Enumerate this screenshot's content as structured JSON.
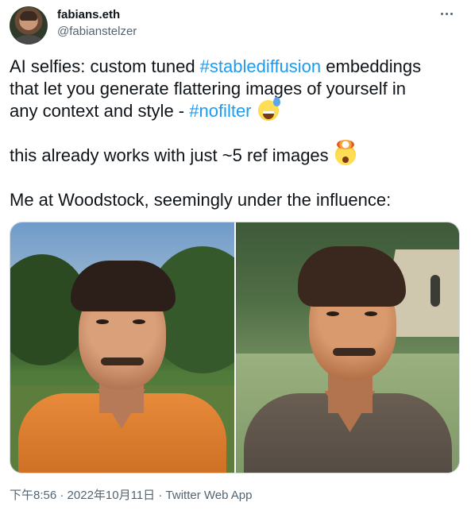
{
  "author": {
    "display_name": "fabians.eth",
    "handle": "@fabianstelzer",
    "avatar_icon": "profile-photo"
  },
  "more_icon": "more-horizontal-icon",
  "tweet": {
    "p1_line1_before": "AI selfies: custom tuned ",
    "p1_hashtag1": "#stablediffusion",
    "p1_line1_after": " embeddings",
    "p1_line2": "that let you generate flattering images of yourself in",
    "p1_line3_before": "any context and style - ",
    "p1_hashtag2": "#nofilter",
    "p1_emoji": "grinning-face-with-sweat-emoji",
    "p2_text": "this already works with just ~5 ref images",
    "p2_emoji": "exploding-head-emoji",
    "p3_text": "Me at Woodstock, seemingly under the influence:"
  },
  "media": {
    "images": [
      {
        "subject": "man-in-orange-shirt-outdoors"
      },
      {
        "subject": "man-in-brown-shirt-field-with-tent"
      }
    ]
  },
  "meta": {
    "time": "下午8:56",
    "separator": " · ",
    "date": "2022年10月11日",
    "source": "Twitter Web App"
  },
  "colors": {
    "link": "#1d9bf0",
    "text": "#0f1419",
    "secondary": "#536471"
  }
}
